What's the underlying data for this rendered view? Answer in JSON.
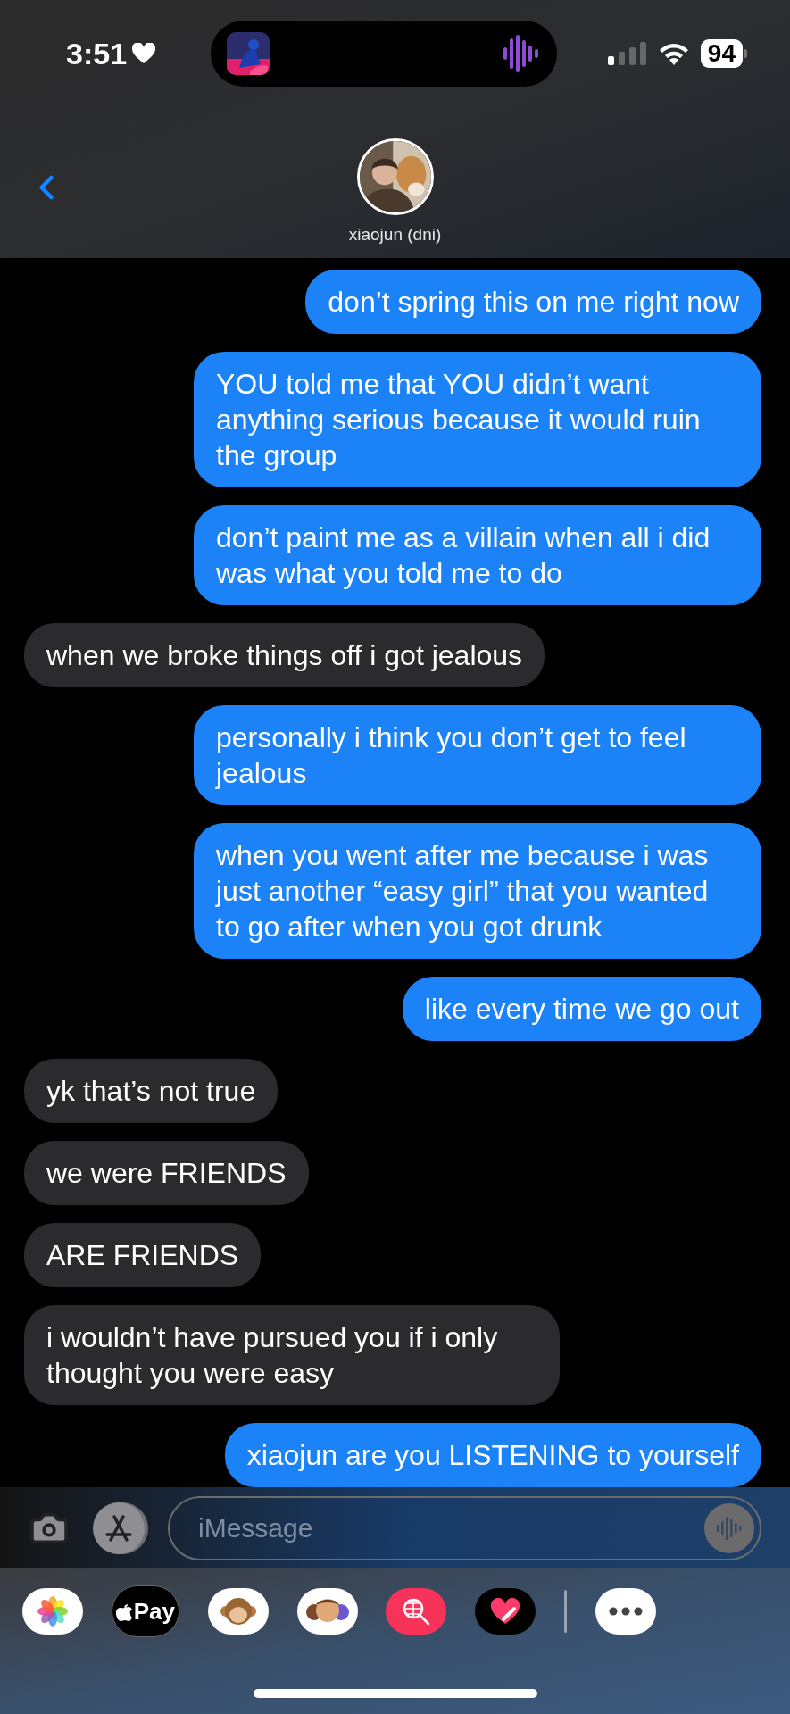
{
  "status_bar": {
    "time": "3:51",
    "battery": "94"
  },
  "contact": {
    "name": "xiaojun (dni)"
  },
  "messages": [
    {
      "kind": "me",
      "text": "don’t spring this on me right now"
    },
    {
      "kind": "me",
      "text": "YOU told me that YOU didn’t want anything serious because it would ruin the group"
    },
    {
      "kind": "me",
      "text": "don’t paint me as a villain when all i did was what you told me to do"
    },
    {
      "kind": "them",
      "text": "when we broke things off i got jealous"
    },
    {
      "kind": "me",
      "text": "personally i think you don’t get to feel jealous"
    },
    {
      "kind": "me",
      "text": "when you went after me because i was just another “easy girl” that you wanted to go after when you got drunk"
    },
    {
      "kind": "me",
      "text": "like every time we go out"
    },
    {
      "kind": "them",
      "text": "yk that’s not true"
    },
    {
      "kind": "them",
      "text": "we were FRIENDS"
    },
    {
      "kind": "them",
      "text": "ARE FRIENDS"
    },
    {
      "kind": "them",
      "text": "i wouldn’t have pursued you if i only thought you were easy"
    },
    {
      "kind": "me",
      "text": "xiaojun are you LISTENING to yourself"
    }
  ],
  "input": {
    "placeholder": "iMessage"
  },
  "apps": [
    {
      "kind": "photos"
    },
    {
      "kind": "pay",
      "label": "Pay"
    },
    {
      "kind": "monkey"
    },
    {
      "kind": "memoji"
    },
    {
      "kind": "search"
    },
    {
      "kind": "heart"
    },
    {
      "kind": "divider"
    },
    {
      "kind": "more"
    }
  ]
}
